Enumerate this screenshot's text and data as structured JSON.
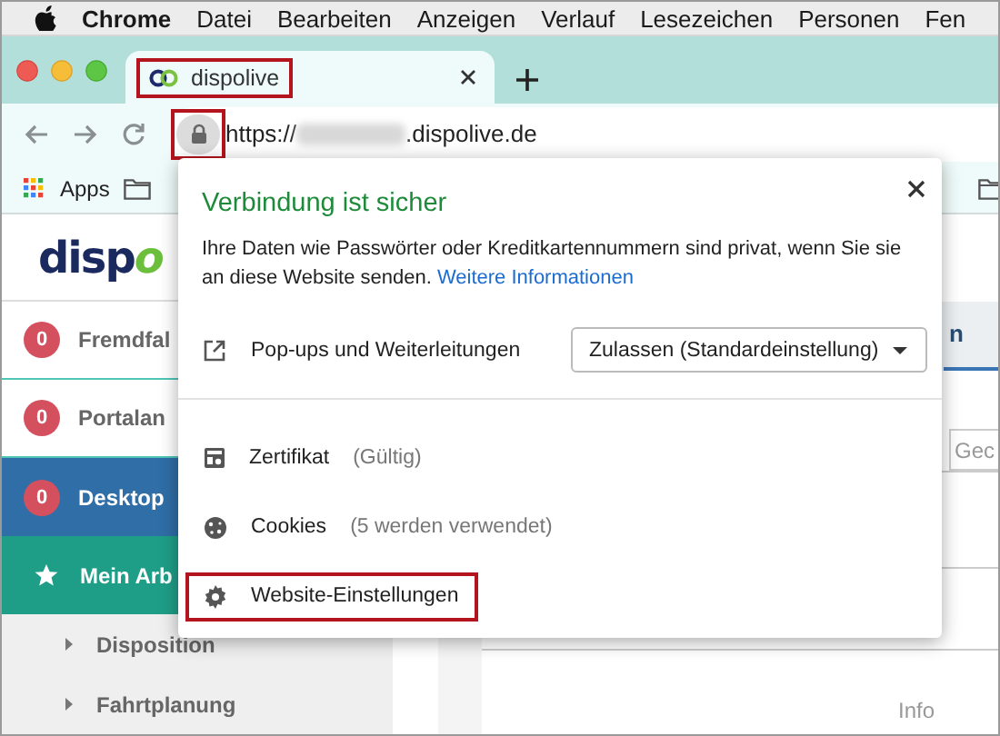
{
  "menu_bar": {
    "items": [
      "Chrome",
      "Datei",
      "Bearbeiten",
      "Anzeigen",
      "Verlauf",
      "Lesezeichen",
      "Personen",
      "Fen"
    ]
  },
  "tabs": [
    {
      "title": "dispolive",
      "selected": true,
      "highlighted": true
    }
  ],
  "address_bar": {
    "url_prefix": "https://",
    "url_suffix": ".dispolive.de",
    "lock_highlighted": true
  },
  "bookmarks": [
    {
      "kind": "apps",
      "label": "Apps"
    },
    {
      "kind": "folder"
    },
    {
      "kind": "folder"
    }
  ],
  "sidebar": {
    "logo_main": "disp",
    "logo_accent": "o",
    "items": [
      {
        "kind": "counter",
        "count": "0",
        "label": "Fremdfal"
      },
      {
        "kind": "counter",
        "count": "0",
        "label": "Portalan"
      },
      {
        "kind": "counter",
        "count": "0",
        "label": "Desktop",
        "color": "#2f6ea6"
      },
      {
        "kind": "star",
        "label": "Mein Arb",
        "color": "#1f9e87",
        "children": [
          {
            "label": "Disposition"
          },
          {
            "label": "Fahrtplanung"
          }
        ]
      }
    ]
  },
  "main": {
    "tab_label": "n",
    "search_placeholder": "Gec",
    "info_label": "Info"
  },
  "popup": {
    "title": "Verbindung ist sicher",
    "message": "Ihre Daten wie Passwörter oder Kreditkartennummern sind privat, wenn Sie sie an diese Website senden.",
    "link": "Weitere Informationen",
    "permission": {
      "label": "Pop-ups und Weiterleitungen",
      "value": "Zulassen (Standardeinstellung)"
    },
    "items": [
      {
        "kind": "certificate",
        "label": "Zertifikat",
        "detail": "(Gültig)",
        "highlighted": false
      },
      {
        "kind": "cookies",
        "label": "Cookies",
        "detail": "(5 werden verwendet)",
        "highlighted": false
      },
      {
        "kind": "settings",
        "label": "Website-Einstellungen",
        "highlighted": true
      }
    ]
  }
}
